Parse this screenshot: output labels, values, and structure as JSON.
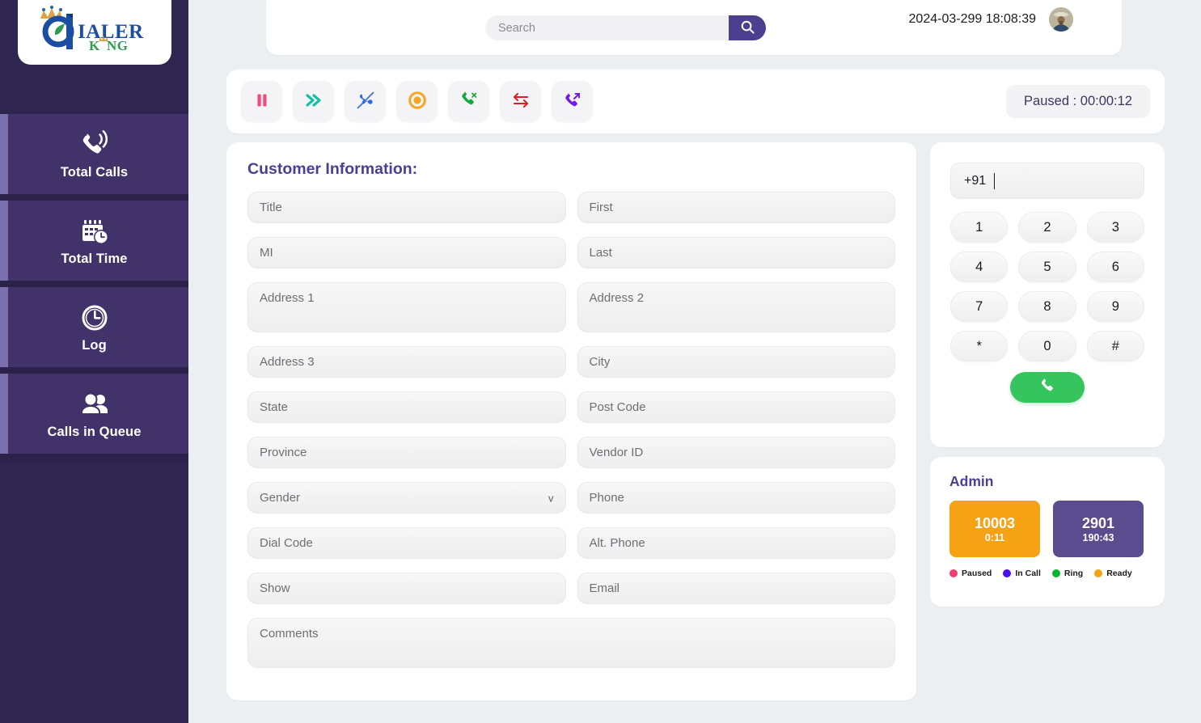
{
  "brand": {
    "logo_text_main": "IALER",
    "logo_text_sub": "KING",
    "logo_letter": "D",
    "name": "Dialer King"
  },
  "sidebar": {
    "items": [
      {
        "label": "Total Calls",
        "icon": "phone-ringing-icon",
        "active": true
      },
      {
        "label": "Total Time",
        "icon": "calendar-clock-icon",
        "active": true
      },
      {
        "label": "Log",
        "icon": "clock-icon",
        "active": true
      },
      {
        "label": "Calls in Queue",
        "icon": "users-icon",
        "active": true
      }
    ]
  },
  "header": {
    "search": {
      "placeholder": "Search",
      "value": "",
      "button_icon": "search-icon"
    },
    "datetime": "2024-03-299 18:08:39",
    "avatar_icon": "user-avatar"
  },
  "toolbar": {
    "buttons": [
      {
        "name": "pause-button",
        "icon": "pause-icon",
        "color": "#f5487f"
      },
      {
        "name": "fast-forward-button",
        "icon": "double-chevron-right-icon",
        "color": "#18bfa5"
      },
      {
        "name": "call-missed-button",
        "icon": "phone-slash-icon",
        "color": "#3168e8"
      },
      {
        "name": "record-button",
        "icon": "record-target-icon",
        "color": "#f5a623"
      },
      {
        "name": "hangup-button",
        "icon": "phone-x-icon",
        "color": "#19a83c"
      },
      {
        "name": "transfer-button",
        "icon": "transfer-arrows-icon",
        "color": "#e01b24"
      },
      {
        "name": "outgoing-call-button",
        "icon": "phone-outgoing-icon",
        "color": "#7218e8"
      }
    ],
    "status": "Paused : 00:00:12"
  },
  "customer": {
    "title": "Customer Information:",
    "fields": [
      {
        "name": "title-field",
        "label": "Title",
        "value": "",
        "type": "text",
        "col": "left"
      },
      {
        "name": "first-name-field",
        "label": "First",
        "value": "",
        "type": "text",
        "col": "right"
      },
      {
        "name": "mi-field",
        "label": "MI",
        "value": "",
        "type": "text",
        "col": "left"
      },
      {
        "name": "last-name-field",
        "label": "Last",
        "value": "",
        "type": "text",
        "col": "right"
      },
      {
        "name": "address1-field",
        "label": "Address 1",
        "value": "",
        "type": "textarea",
        "col": "left"
      },
      {
        "name": "address2-field",
        "label": "Address 2",
        "value": "",
        "type": "textarea",
        "col": "right"
      },
      {
        "name": "address3-field",
        "label": "Address 3",
        "value": "",
        "type": "text",
        "col": "left"
      },
      {
        "name": "city-field",
        "label": "City",
        "value": "",
        "type": "text",
        "col": "right"
      },
      {
        "name": "state-field",
        "label": "State",
        "value": "",
        "type": "text",
        "col": "left"
      },
      {
        "name": "post-code-field",
        "label": "Post Code",
        "value": "",
        "type": "text",
        "col": "right"
      },
      {
        "name": "province-field",
        "label": "Province",
        "value": "",
        "type": "text",
        "col": "left"
      },
      {
        "name": "vendor-id-field",
        "label": "Vendor  ID",
        "value": "",
        "type": "text",
        "col": "right"
      },
      {
        "name": "gender-select",
        "label": "Gender",
        "value": "",
        "type": "select",
        "col": "left"
      },
      {
        "name": "phone-field",
        "label": "Phone",
        "value": "",
        "type": "text",
        "col": "right"
      },
      {
        "name": "dial-code-field",
        "label": "Dial Code",
        "value": "",
        "type": "text",
        "col": "left"
      },
      {
        "name": "alt-phone-field",
        "label": "Alt. Phone",
        "value": "",
        "type": "text",
        "col": "right"
      },
      {
        "name": "show-field",
        "label": "Show",
        "value": "",
        "type": "text",
        "col": "left"
      },
      {
        "name": "email-field",
        "label": "Email",
        "value": "",
        "type": "text",
        "col": "right"
      },
      {
        "name": "comments-field",
        "label": "Comments",
        "value": "",
        "type": "textarea-full",
        "col": "full"
      }
    ],
    "gender_chevron": "v"
  },
  "dialpad": {
    "prefix": "+91",
    "number": "",
    "keys": [
      "1",
      "2",
      "3",
      "4",
      "5",
      "6",
      "7",
      "8",
      "9",
      "*",
      "0",
      "#"
    ],
    "call_icon": "phone-icon"
  },
  "admin": {
    "title": "Admin",
    "agents": [
      {
        "id": "10003",
        "time": "0:11",
        "color": "#f5a314",
        "status": "Ready"
      },
      {
        "id": "2901",
        "time": "190:43",
        "color": "#5b4b8f",
        "status": "In Call"
      }
    ],
    "legend": [
      {
        "label": "Paused",
        "color": "#ef3d72"
      },
      {
        "label": "In Call",
        "color": "#4b0ff0"
      },
      {
        "label": "Ring",
        "color": "#07b62f"
      },
      {
        "label": "Ready",
        "color": "#f5a314"
      }
    ]
  },
  "colors": {
    "sidebar_bg": "#2e2551",
    "nav_bg": "#413269",
    "nav_accent": "#7a70ad",
    "page_bg": "#eceff1",
    "brand_purple": "#4b3f93",
    "search_btn": "#4d3f8f",
    "call_green": "#35c45e"
  }
}
